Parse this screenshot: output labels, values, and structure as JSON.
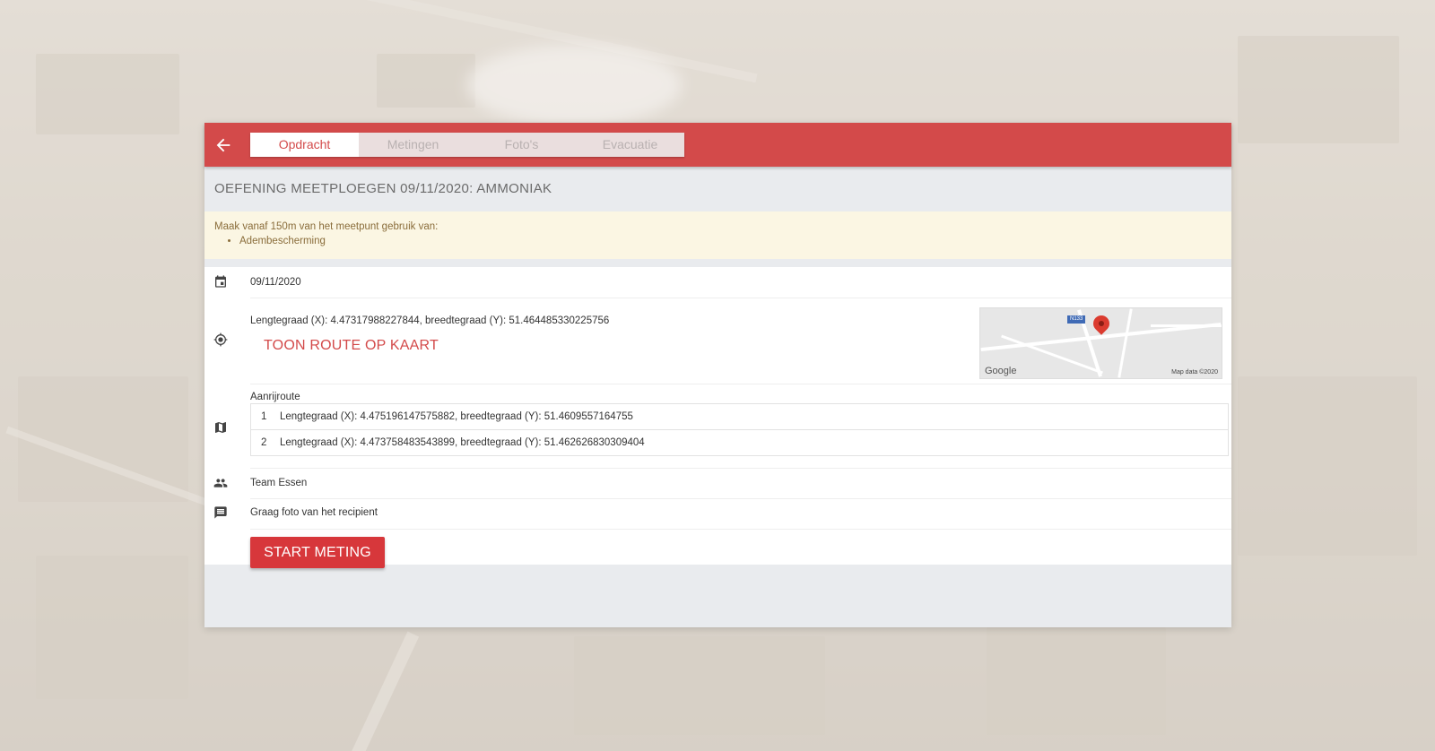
{
  "header": {
    "back_icon": "arrow-left-icon",
    "tabs": [
      {
        "label": "Opdracht",
        "active": true
      },
      {
        "label": "Metingen",
        "active": false
      },
      {
        "label": "Foto's",
        "active": false
      },
      {
        "label": "Evacuatie",
        "active": false
      }
    ]
  },
  "assignment": {
    "title": "OEFENING MEETPLOEGEN 09/11/2020: AMMONIAK",
    "notice": {
      "text": "Maak vanaf 150m van het meetpunt gebruik van:",
      "items": [
        "Adembescherming"
      ]
    },
    "date": "09/11/2020",
    "location": {
      "coordinates": "Lengtegraad (X): 4.47317988227844, breedtegraad (Y): 51.464485330225756",
      "route_link": "TOON ROUTE OP KAART",
      "map": {
        "road_shield": "N133",
        "logo": "Google",
        "attribution": "Map data ©2020"
      }
    },
    "approach_route": {
      "label": "Aanrijroute",
      "items": [
        {
          "num": "1",
          "value": "Lengtegraad (X): 4.475196147575882, breedtegraad (Y): 51.4609557164755"
        },
        {
          "num": "2",
          "value": "Lengtegraad (X): 4.473758483543899, breedtegraad (Y): 51.462626830309404"
        }
      ]
    },
    "team": "Team Essen",
    "comment": "Graag foto van het recipient",
    "start_button": "START METING"
  },
  "colors": {
    "primary": "#d34a4a",
    "button": "#d7373b",
    "notice_bg": "#fbf6e3",
    "notice_text": "#8a6d3b"
  }
}
